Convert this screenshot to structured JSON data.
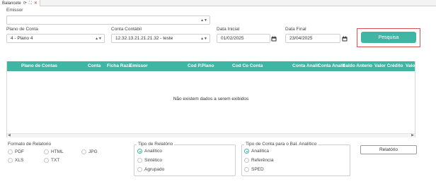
{
  "tab": {
    "title": "Balancete",
    "icons": [
      "refresh-icon",
      "expand-icon",
      "close-icon"
    ]
  },
  "filters": {
    "emissor": {
      "label": "Emissor",
      "value": ""
    },
    "plano_conta": {
      "label": "Plano de Conta",
      "value": "4 - Plano 4"
    },
    "conta_contabil": {
      "label": "Conta Contábil",
      "value": "12.32.13.21.21.21.32 - teste"
    },
    "data_inicial": {
      "label": "Data Inicial",
      "value": "01/02/2025"
    },
    "data_final": {
      "label": "Data Final",
      "value": "23/04/2025"
    },
    "search_button": "Pesquisa"
  },
  "grid": {
    "columns": [
      "Plano de Contas",
      "Conta",
      "Ficha Razã",
      "Emissor",
      "Cod P.Plano",
      "Cod Co Conta",
      "Conta Analit",
      "Conta Analit",
      "Saldo Anterio",
      "Valor Crédito",
      "Valo"
    ],
    "empty_message": "Não existem dados a serem exibidos"
  },
  "formato": {
    "title": "Formato de Relatorio",
    "options": [
      "PDF",
      "HTML",
      "JPG",
      "XLS",
      "TXT"
    ]
  },
  "tipo_relatorio": {
    "title": "Tipo de Relatório",
    "options": [
      "Analítico",
      "Sintético",
      "Agrupado"
    ],
    "selected": "Analítico"
  },
  "tipo_conta": {
    "title": "Tipo de Conta para o Bal. Analítico",
    "options": [
      "Analítica",
      "Referência",
      "SPED"
    ],
    "selected": "Analítica"
  },
  "report_button": "Relatório",
  "colors": {
    "accent": "#3fb6a3",
    "highlight": "#d9534f"
  }
}
